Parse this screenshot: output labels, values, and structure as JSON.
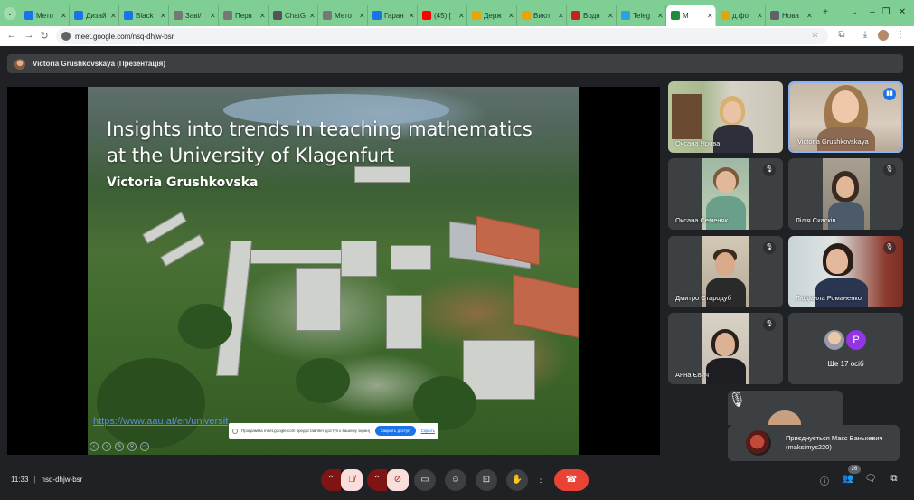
{
  "browser": {
    "tabs": [
      {
        "label": "Мето",
        "color": "#1a73e8"
      },
      {
        "label": "Дизай",
        "color": "#1a73e8"
      },
      {
        "label": "Black",
        "color": "#1a73e8"
      },
      {
        "label": "Заві/",
        "color": "#777777"
      },
      {
        "label": "Перв",
        "color": "#777777"
      },
      {
        "label": "ChatG",
        "color": "#555555"
      },
      {
        "label": "Мето",
        "color": "#777777"
      },
      {
        "label": "Гаран",
        "color": "#1a73e8"
      },
      {
        "label": "(45) [",
        "color": "#ff0000"
      },
      {
        "label": "Держ",
        "color": "#e5a50a"
      },
      {
        "label": "Викл",
        "color": "#e5a50a"
      },
      {
        "label": "Водн",
        "color": "#c5221f"
      },
      {
        "label": "Teleg",
        "color": "#2aa3df"
      },
      {
        "label": "M",
        "color": "#1e8e3e"
      },
      {
        "label": "д.фо",
        "color": "#e5a50a"
      },
      {
        "label": "Нова",
        "color": "#5f6368"
      }
    ],
    "new_tab": "+",
    "url": "meet.google.com/nsq-dhjw-bsr"
  },
  "presenter_bar": {
    "label": "Victoria Grushkovskaya (Презентація)"
  },
  "slide": {
    "title_line1": "Insights into trends  in teaching mathematics",
    "title_line2": "at the University of Klagenfurt",
    "author": "Victoria Grushkovska",
    "link": "https://www.aau.at/en/universit"
  },
  "share_notice": {
    "text": "Программа meet.google.com предоставляет доступ к вашему экрану.",
    "stop_button": "Закрыть доступ",
    "hide_link": "Скрыть"
  },
  "participants": [
    {
      "name": "Оксана Ярова",
      "muted": false
    },
    {
      "name": "Victoria Grushkovskaya",
      "muted": false,
      "speaking": true
    },
    {
      "name": "Оксана Семеняк",
      "muted": true
    },
    {
      "name": "Лілія Скасків",
      "muted": true
    },
    {
      "name": "Дмитро Стародуб",
      "muted": true
    },
    {
      "name": "Людмила Романенко",
      "muted": true
    },
    {
      "name": "Анна Євич",
      "muted": true
    }
  ],
  "others": {
    "avatar_letter": "P",
    "label": "Ще 17 осіб"
  },
  "join_toast": {
    "text": "Приєднується Макс Ванькевич (maksimys220)"
  },
  "meeting": {
    "time": "11:33",
    "separator": "|",
    "code": "nsq-dhjw-bsr",
    "participant_count": "26"
  },
  "colors": {
    "tabstrip": "#7fcf95",
    "meet_bg": "#202124",
    "tile_bg": "#3c4043",
    "end_call": "#ea4335",
    "mic_off": "#7f1414",
    "speaking_border": "#8ab4f8"
  }
}
